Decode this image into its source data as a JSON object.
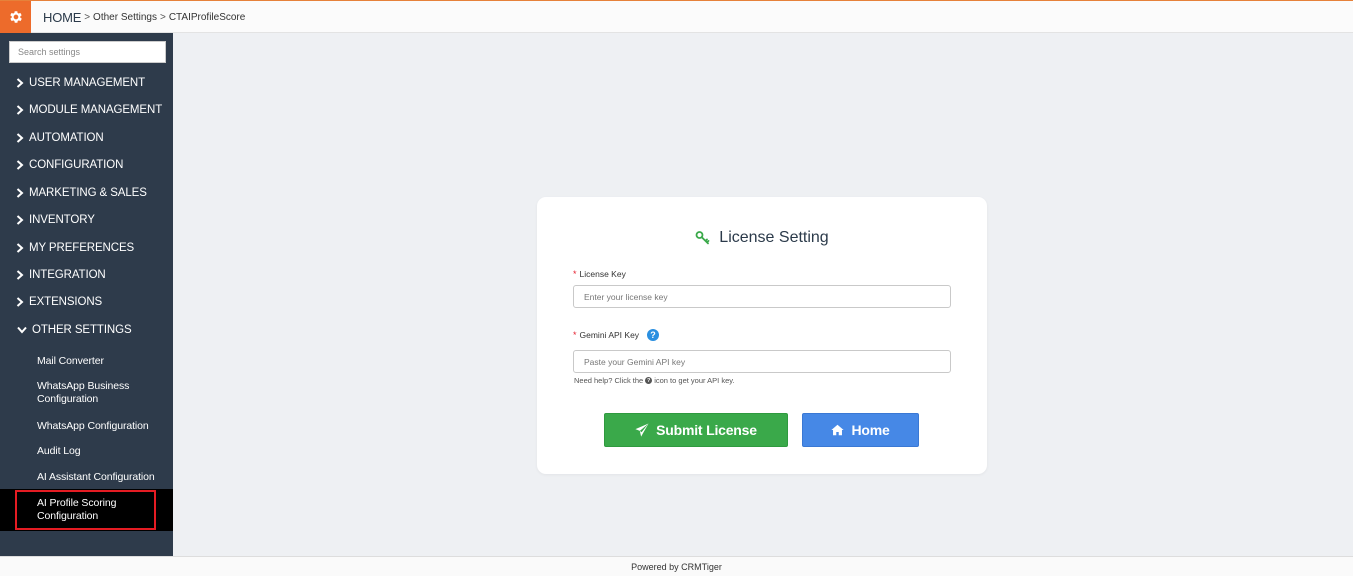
{
  "breadcrumb": {
    "home": "HOME",
    "level1": "Other Settings",
    "level2": "CTAIProfileScore",
    "separator": ">"
  },
  "sidebar": {
    "search_placeholder": "Search settings",
    "sections": [
      {
        "label": "USER MANAGEMENT"
      },
      {
        "label": "MODULE MANAGEMENT"
      },
      {
        "label": "AUTOMATION"
      },
      {
        "label": "CONFIGURATION"
      },
      {
        "label": "MARKETING & SALES"
      },
      {
        "label": "INVENTORY"
      },
      {
        "label": "MY PREFERENCES"
      },
      {
        "label": "INTEGRATION"
      },
      {
        "label": "EXTENSIONS"
      },
      {
        "label": "OTHER SETTINGS"
      }
    ],
    "sub_items": [
      {
        "label": "Mail Converter"
      },
      {
        "label": "WhatsApp Business Configuration"
      },
      {
        "label": "WhatsApp Configuration"
      },
      {
        "label": "Audit Log"
      },
      {
        "label": "AI Assistant Configuration"
      },
      {
        "label": "AI Profile Scoring Configuration"
      }
    ]
  },
  "form": {
    "title": "License Setting",
    "license_key_label": "License Key",
    "license_key_placeholder": "Enter your license key",
    "gemini_label": "Gemini API Key",
    "gemini_placeholder": "Paste your Gemini API key",
    "help_text_before": "Need help? Click the",
    "help_text_after": "icon to get your API key.",
    "submit_label": "Submit License",
    "home_label": "Home"
  },
  "footer": {
    "text": "Powered by CRMTiger"
  },
  "colors": {
    "accent_orange": "#ed6b2b",
    "sidebar_bg": "#2e3b4b",
    "submit_green": "#3aa94a",
    "home_blue": "#4688e6",
    "required_red": "#e5202f",
    "active_border": "#e51c23"
  },
  "icons": {
    "settings": "gear-icon",
    "section_collapsed": "chevron-right-icon",
    "section_expanded": "chevron-down-icon",
    "title": "key-icon",
    "help": "question-circle-icon",
    "submit": "paper-plane-icon",
    "home": "home-icon"
  }
}
